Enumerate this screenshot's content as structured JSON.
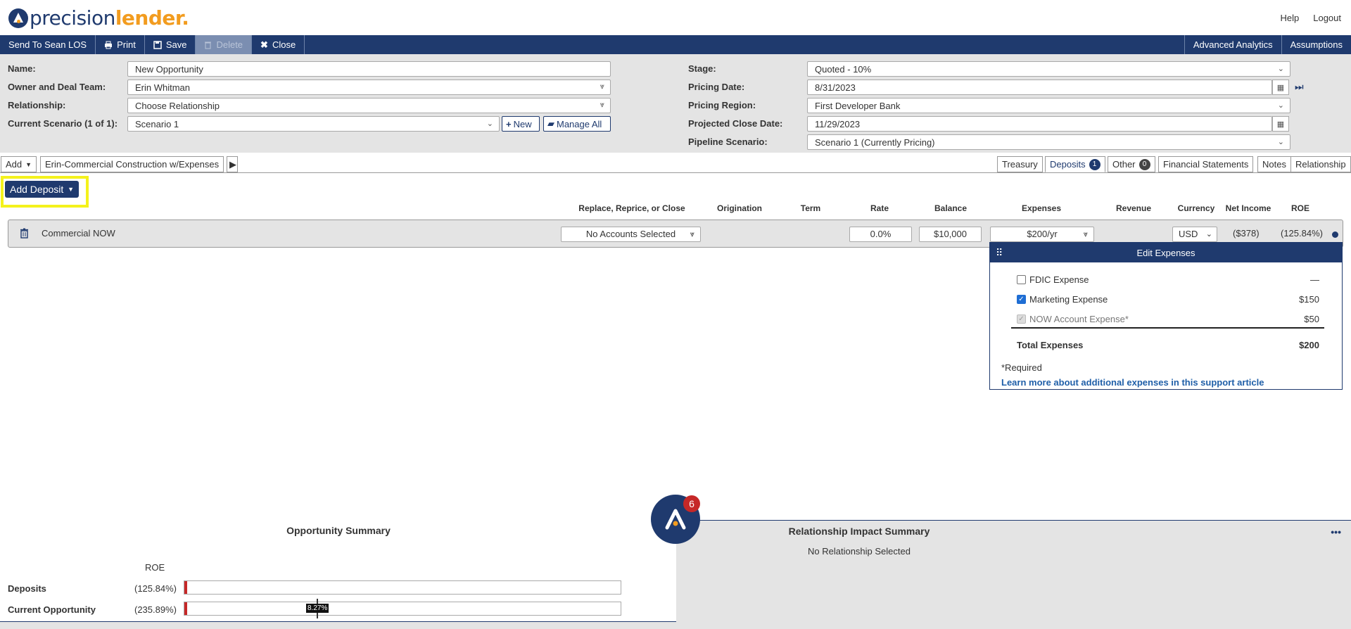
{
  "header": {
    "logo_text_1": "precision",
    "logo_text_2": "lender.",
    "links": [
      "Help",
      "Logout"
    ]
  },
  "toolbar": {
    "send_label": "Send To Sean LOS",
    "print_label": "Print",
    "save_label": "Save",
    "delete_label": "Delete",
    "close_label": "Close",
    "analytics_label": "Advanced Analytics",
    "assumptions_label": "Assumptions"
  },
  "form": {
    "name_label": "Name:",
    "name_value": "New Opportunity",
    "owner_label": "Owner and Deal Team:",
    "owner_value": "Erin Whitman",
    "relationship_label": "Relationship:",
    "relationship_value": "Choose Relationship",
    "scenario_label": "Current Scenario (1 of 1):",
    "scenario_value": "Scenario 1",
    "new_label": "New",
    "manage_all_label": "Manage All",
    "stage_label": "Stage:",
    "stage_value": "Quoted - 10%",
    "pricing_date_label": "Pricing Date:",
    "pricing_date_value": "8/31/2023",
    "pricing_region_label": "Pricing Region:",
    "pricing_region_value": "First Developer Bank",
    "close_date_label": "Projected Close Date:",
    "close_date_value": "11/29/2023",
    "pipeline_label": "Pipeline Scenario:",
    "pipeline_value": "Scenario 1 (Currently Pricing)"
  },
  "tabs": {
    "add_label": "Add",
    "scenario_tab": "Erin-Commercial Construction w/Expenses",
    "treasury": "Treasury",
    "deposits": "Deposits",
    "deposits_count": "1",
    "other": "Other",
    "other_count": "0",
    "financial": "Financial Statements",
    "notes": "Notes",
    "relationship": "Relationship"
  },
  "deposits": {
    "add_button": "Add Deposit",
    "columns": [
      "Replace, Reprice, or Close",
      "Origination",
      "Term",
      "Rate",
      "Balance",
      "Expenses",
      "Revenue",
      "Currency",
      "Net Income",
      "ROE"
    ],
    "row": {
      "name": "Commercial NOW",
      "replace": "No Accounts Selected",
      "rate": "0.0%",
      "balance": "$10,000",
      "expenses": "$200/yr",
      "currency": "USD",
      "net_income": "($378)",
      "roe": "(125.84%)"
    }
  },
  "edit_expenses": {
    "title": "Edit Expenses",
    "items": [
      {
        "label": "FDIC Expense",
        "amount": "—",
        "checked": false
      },
      {
        "label": "Marketing Expense",
        "amount": "$150",
        "checked": true
      },
      {
        "label": "NOW Account Expense*",
        "amount": "$50",
        "checked": true
      }
    ],
    "total_label": "Total Expenses",
    "total_amount": "$200",
    "required_note": "*Required",
    "support_link": "Learn more about additional expenses in this support article"
  },
  "opportunity_summary": {
    "title": "Opportunity Summary",
    "roe_header": "ROE",
    "rows": [
      {
        "label": "Deposits",
        "value": "(125.84%)"
      },
      {
        "label": "Current Opportunity",
        "value": "(235.89%)",
        "marker": "8.27%"
      }
    ]
  },
  "relationship_summary": {
    "title": "Relationship Impact Summary",
    "subtitle": "No Relationship Selected",
    "more": "•••"
  },
  "assistant": {
    "badge_count": "6"
  },
  "colors": {
    "brand_navy": "#1f3a6e",
    "brand_orange": "#f29c1f",
    "highlight_yellow": "#f4f21c",
    "negative_red": "#c62828"
  }
}
